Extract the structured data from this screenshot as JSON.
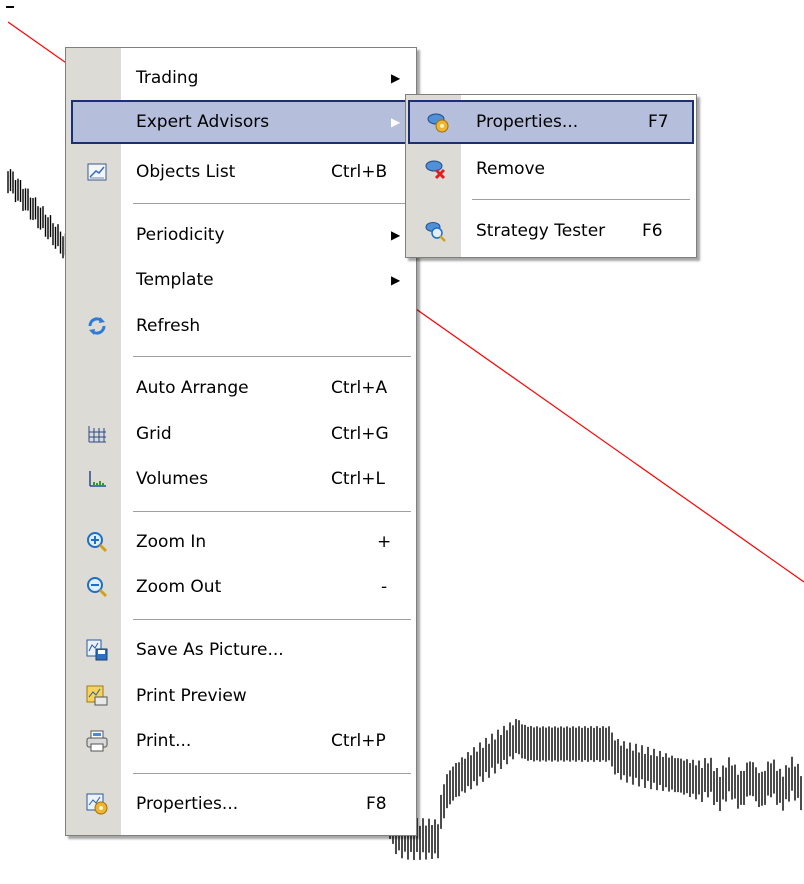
{
  "main_menu": {
    "items": [
      {
        "label": "Trading",
        "shortcut": "",
        "submenu": true,
        "icon": ""
      },
      {
        "label": "Expert Advisors",
        "shortcut": "",
        "submenu": true,
        "icon": "",
        "highlighted": true
      },
      {
        "label": "Objects List",
        "shortcut": "Ctrl+B",
        "icon": "objects-list-icon"
      },
      {
        "label": "Periodicity",
        "shortcut": "",
        "submenu": true,
        "icon": ""
      },
      {
        "label": "Template",
        "shortcut": "",
        "submenu": true,
        "icon": ""
      },
      {
        "label": "Refresh",
        "shortcut": "",
        "icon": "refresh-icon"
      },
      {
        "label": "Auto Arrange",
        "shortcut": "Ctrl+A",
        "icon": ""
      },
      {
        "label": "Grid",
        "shortcut": "Ctrl+G",
        "icon": "grid-icon"
      },
      {
        "label": "Volumes",
        "shortcut": "Ctrl+L",
        "icon": "volumes-icon"
      },
      {
        "label": "Zoom In",
        "shortcut": "+",
        "icon": "zoom-in-icon"
      },
      {
        "label": "Zoom Out",
        "shortcut": "-",
        "icon": "zoom-out-icon"
      },
      {
        "label": "Save As Picture...",
        "shortcut": "",
        "icon": "save-picture-icon"
      },
      {
        "label": "Print Preview",
        "shortcut": "",
        "icon": "print-preview-icon"
      },
      {
        "label": "Print...",
        "shortcut": "Ctrl+P",
        "icon": "print-icon"
      },
      {
        "label": "Properties...",
        "shortcut": "F8",
        "icon": "chart-properties-icon"
      }
    ]
  },
  "submenu": {
    "items": [
      {
        "label": "Properties...",
        "shortcut": "F7",
        "icon": "expert-properties-icon",
        "highlighted": true
      },
      {
        "label": "Remove",
        "shortcut": "",
        "icon": "expert-remove-icon"
      },
      {
        "label": "Strategy Tester",
        "shortcut": "F6",
        "icon": "strategy-tester-icon"
      }
    ]
  },
  "colors": {
    "highlight_bg": "#b5bedb",
    "highlight_border": "#1c2f74",
    "gutter": "#dcdbd6",
    "trendline": "#ff0000"
  }
}
